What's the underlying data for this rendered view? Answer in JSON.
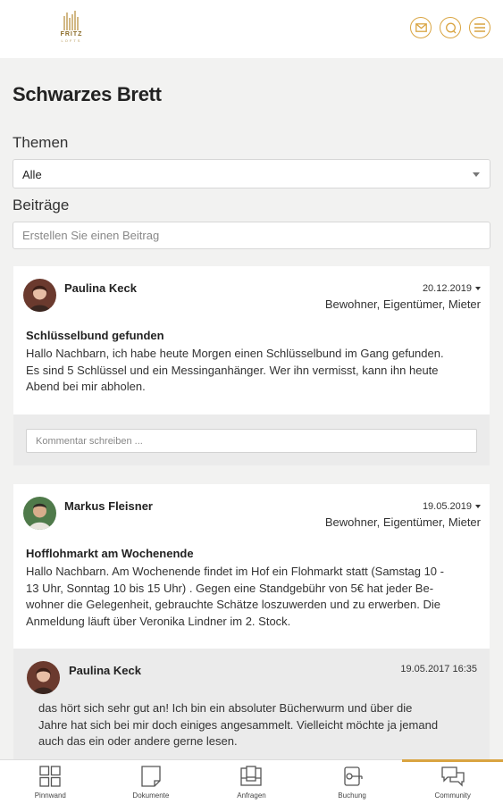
{
  "header": {
    "logo_text": "FRITZ",
    "logo_sub": "LOFTS",
    "icons": [
      "mail-icon",
      "chat-icon",
      "menu-icon"
    ]
  },
  "page": {
    "title": "Schwarzes Brett",
    "themes_label": "Themen",
    "themes_selected": "Alle",
    "posts_label": "Beiträge",
    "post_placeholder": "Erstellen Sie einen Beitrag"
  },
  "posts": [
    {
      "author": "Paulina Keck",
      "date": "20.12.2019",
      "audience": "Bewohner, Eigentümer, Mieter",
      "title": "Schlüsselbund gefunden",
      "lines": [
        "Hallo Nachbarn, ich habe heute Morgen einen Schlüsselbund im Gang gefunden.",
        "Es sind 5 Schlüssel und ein Messinganhänger. Wer ihn vermisst, kann ihn heute",
        "Abend bei mir abholen."
      ],
      "comment_placeholder": "Kommentar schreiben ..."
    },
    {
      "author": "Markus Fleisner",
      "date": "19.05.2019",
      "audience": "Bewohner, Eigentümer, Mieter",
      "title": "Hofflohmarkt am Wochenende",
      "lines": [
        "Hallo Nachbarn. Am Wochenende findet im Hof ein Flohmarkt statt (Samstag 10 -",
        "13 Uhr, Sonntag 10 bis 15 Uhr) . Gegen eine Standgebühr von 5€ hat jeder Be-",
        "wohner die Gelegenheit, gebrauchte Schätze loszuwerden und zu erwerben. Die",
        "Anmeldung läuft über Veronika Lindner im 2. Stock."
      ],
      "reply": {
        "author": "Paulina Keck",
        "date": "19.05.2017 16:35",
        "lines": [
          "das hört sich sehr gut an! Ich bin ein absoluter Bücherwurm und über die",
          "Jahre hat sich bei mir doch einiges angesammelt. Vielleicht möchte ja jemand",
          "auch das ein oder andere gerne lesen."
        ]
      }
    }
  ],
  "tabs": [
    {
      "label": "Pinnwand",
      "icon": "grid-icon"
    },
    {
      "label": "Dokumente",
      "icon": "document-icon"
    },
    {
      "label": "Anfragen",
      "icon": "inbox-icon"
    },
    {
      "label": "Buchung",
      "icon": "key-icon"
    },
    {
      "label": "Community",
      "icon": "chat-bubbles-icon"
    }
  ],
  "active_tab": "Community",
  "colors": {
    "accent": "#d9a441",
    "background": "#f2f2f1",
    "card": "#ffffff",
    "reply_bg": "#ebebeb"
  }
}
